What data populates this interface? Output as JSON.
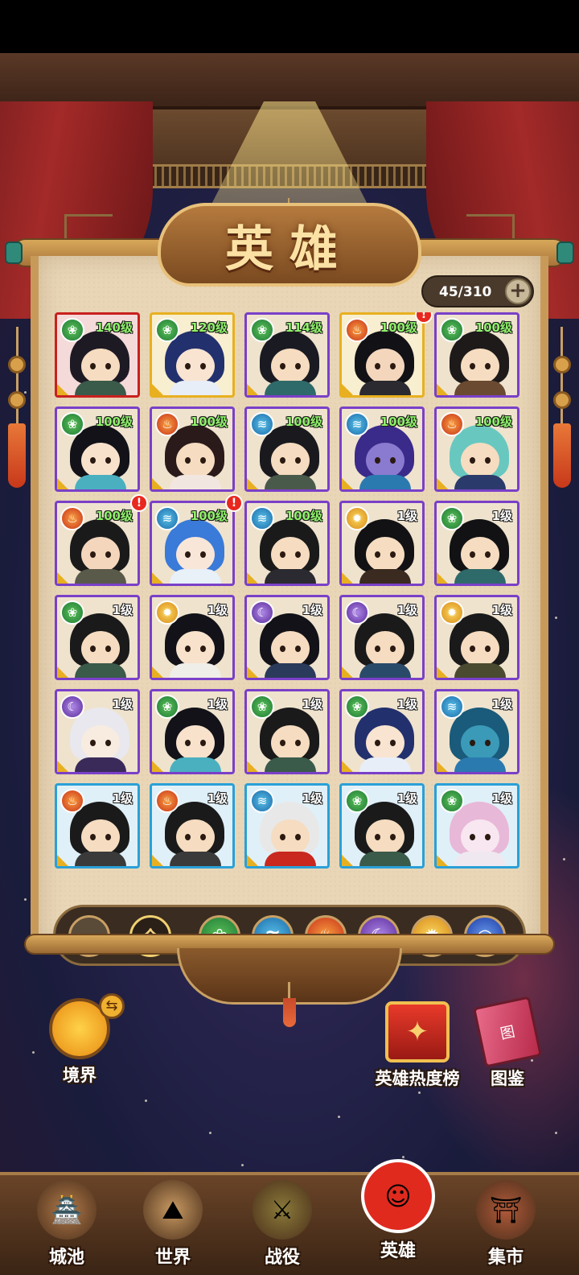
{
  "title": "英雄",
  "hero_count": "45/310",
  "heroes": [
    {
      "level": "140级",
      "element": "wood",
      "rarity": "red",
      "alert": false,
      "skin": "#f6dcc0",
      "hair": "#1e1a24",
      "robe": "#3a5a4a"
    },
    {
      "level": "120级",
      "element": "wood",
      "rarity": "gold",
      "alert": false,
      "skin": "#f8e4d0",
      "hair": "#23306e",
      "robe": "#e8eef8"
    },
    {
      "level": "114级",
      "element": "wood",
      "rarity": "purple",
      "alert": false,
      "skin": "#f6dcc0",
      "hair": "#1a1a22",
      "robe": "#2f6a6a"
    },
    {
      "level": "100级",
      "element": "fire",
      "rarity": "gold",
      "alert": true,
      "skin": "#f3d6bc",
      "hair": "#111116",
      "robe": "#2a2a30"
    },
    {
      "level": "100级",
      "element": "wood",
      "rarity": "purple",
      "alert": false,
      "skin": "#f6dcc0",
      "hair": "#1e1a1a",
      "robe": "#6a4a30"
    },
    {
      "level": "100级",
      "element": "wood",
      "rarity": "purple",
      "alert": false,
      "skin": "#f8e2cc",
      "hair": "#121218",
      "robe": "#4ab0c0"
    },
    {
      "level": "100级",
      "element": "fire",
      "rarity": "purple",
      "alert": false,
      "skin": "#f6dcc0",
      "hair": "#2a1a1a",
      "robe": "#f2e6e0"
    },
    {
      "level": "100级",
      "element": "water",
      "rarity": "purple",
      "alert": false,
      "skin": "#f6dcc0",
      "hair": "#1a1a1e",
      "robe": "#4a5a4a"
    },
    {
      "level": "100级",
      "element": "water",
      "rarity": "purple",
      "alert": false,
      "skin": "#8a7ad0",
      "hair": "#3a2a8a",
      "robe": "#2a7ab0"
    },
    {
      "level": "100级",
      "element": "fire",
      "rarity": "purple",
      "alert": false,
      "skin": "#f6dcc0",
      "hair": "#68c8c0",
      "robe": "#2a3a6a"
    },
    {
      "level": "100级",
      "element": "fire",
      "rarity": "purple",
      "alert": true,
      "skin": "#f3d6bc",
      "hair": "#1a1a1a",
      "robe": "#5a5a4a"
    },
    {
      "level": "100级",
      "element": "water",
      "rarity": "purple",
      "alert": true,
      "skin": "#f8e6d8",
      "hair": "#3a7ad8",
      "robe": "#e8f0f8"
    },
    {
      "level": "100级",
      "element": "water",
      "rarity": "purple",
      "alert": false,
      "skin": "#f6dcc0",
      "hair": "#1a1a1a",
      "robe": "#2a2a30"
    },
    {
      "level": "1级",
      "element": "sun",
      "rarity": "purple",
      "alert": false,
      "skin": "#f6dcc0",
      "hair": "#121214",
      "robe": "#3a2a20"
    },
    {
      "level": "1级",
      "element": "wood",
      "rarity": "purple",
      "alert": false,
      "skin": "#f6dcc0",
      "hair": "#121214",
      "robe": "#2f6a6a"
    },
    {
      "level": "1级",
      "element": "wood",
      "rarity": "purple",
      "alert": false,
      "skin": "#f6dcc0",
      "hair": "#1a1a1a",
      "robe": "#3a5a4a"
    },
    {
      "level": "1级",
      "element": "sun",
      "rarity": "purple",
      "alert": false,
      "skin": "#f8e2cc",
      "hair": "#121218",
      "robe": "#f0eee8"
    },
    {
      "level": "1级",
      "element": "moon",
      "rarity": "purple",
      "alert": false,
      "skin": "#f6dcc0",
      "hair": "#121218",
      "robe": "#2a3a5a"
    },
    {
      "level": "1级",
      "element": "moon",
      "rarity": "purple",
      "alert": false,
      "skin": "#f6dcc0",
      "hair": "#1a1a1a",
      "robe": "#2a4a6a"
    },
    {
      "level": "1级",
      "element": "sun",
      "rarity": "purple",
      "alert": false,
      "skin": "#f6dcc0",
      "hair": "#1a1a1a",
      "robe": "#4a4a30"
    },
    {
      "level": "1级",
      "element": "moon",
      "rarity": "purple",
      "alert": false,
      "skin": "#f8ece0",
      "hair": "#e8e8ee",
      "robe": "#3a2a5a"
    },
    {
      "level": "1级",
      "element": "wood",
      "rarity": "purple",
      "alert": false,
      "skin": "#f8e2cc",
      "hair": "#121218",
      "robe": "#4ab0c0"
    },
    {
      "level": "1级",
      "element": "wood",
      "rarity": "purple",
      "alert": false,
      "skin": "#f6dcc0",
      "hair": "#1a1a1a",
      "robe": "#3a5a4a"
    },
    {
      "level": "1级",
      "element": "wood",
      "rarity": "purple",
      "alert": false,
      "skin": "#f8e4d0",
      "hair": "#23306e",
      "robe": "#e8eef8"
    },
    {
      "level": "1级",
      "element": "water",
      "rarity": "purple",
      "alert": false,
      "skin": "#3a9ab8",
      "hair": "#1a5a7a",
      "robe": "#2a7ab0"
    },
    {
      "level": "1级",
      "element": "fire",
      "rarity": "blue",
      "alert": false,
      "skin": "#f6dcc0",
      "hair": "#1a1a1a",
      "robe": "#3a3a3a"
    },
    {
      "level": "1级",
      "element": "fire",
      "rarity": "blue",
      "alert": false,
      "skin": "#f6dcc0",
      "hair": "#1a1a1a",
      "robe": "#3a3a3a"
    },
    {
      "level": "1级",
      "element": "water",
      "rarity": "blue",
      "alert": false,
      "skin": "#f6dcc0",
      "hair": "#e8e8e8",
      "robe": "#c8281e"
    },
    {
      "level": "1级",
      "element": "wood",
      "rarity": "blue",
      "alert": false,
      "skin": "#f6dcc0",
      "hair": "#1a1a1a",
      "robe": "#3a5a4a"
    },
    {
      "level": "1级",
      "element": "wood",
      "rarity": "blue",
      "alert": false,
      "skin": "#f8e6f0",
      "hair": "#e8b8d8",
      "robe": "#f0e8f0"
    }
  ],
  "filters": {
    "collapse_icon": "chevron-up-icon",
    "all_label": "全",
    "elements": [
      "wood",
      "water",
      "fire",
      "moon",
      "sun",
      "storm"
    ]
  },
  "element_glyphs": {
    "wood": "❀",
    "water": "≋",
    "fire": "♨",
    "moon": "☾",
    "sun": "✹",
    "storm": "◎"
  },
  "shortcuts": {
    "realm_label": "境界",
    "realm_swap_icon": "⇆",
    "ranking_label": "英雄热度榜",
    "ranking_icon_glyph": "✦",
    "codex_label": "图鉴",
    "codex_icon_glyph": "图"
  },
  "nav": [
    {
      "label": "城池",
      "icon": "city-icon",
      "glyph": "🏯",
      "active": false
    },
    {
      "label": "世界",
      "icon": "world-icon",
      "glyph": "⛰",
      "active": false
    },
    {
      "label": "战役",
      "icon": "battle-icon",
      "glyph": "⚔",
      "active": false
    },
    {
      "label": "英雄",
      "icon": "hero-icon",
      "glyph": "☺",
      "active": true
    },
    {
      "label": "集市",
      "icon": "market-icon",
      "glyph": "⛩",
      "active": false
    }
  ]
}
